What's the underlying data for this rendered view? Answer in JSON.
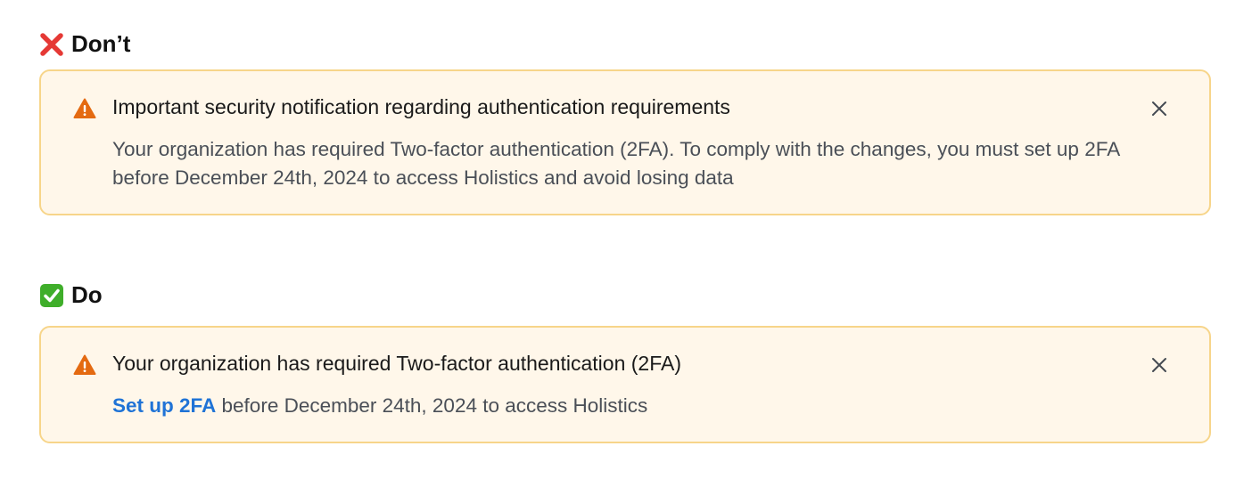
{
  "dont": {
    "heading": "Don’t",
    "icon": "red-x-mark-icon",
    "alert": {
      "title": "Important security notification regarding authentication requirements",
      "body": "Your organization has required Two-factor authentication (2FA). To comply with the changes, you must set up 2FA before December 24th, 2024 to access Holistics and avoid losing data"
    }
  },
  "do": {
    "heading": "Do",
    "icon": "green-check-mark-icon",
    "alert": {
      "title": "Your organization has required Two-factor authentication (2FA)",
      "link_label": "Set up 2FA",
      "body_rest": " before December 24th, 2024 to access Holistics"
    }
  },
  "colors": {
    "alert_background": "#fff7ea",
    "alert_border": "#f7d58a",
    "warning_icon": "#e46a11",
    "link": "#1f73d6",
    "dont_mark": "#e53935",
    "do_mark": "#3fae2a"
  }
}
